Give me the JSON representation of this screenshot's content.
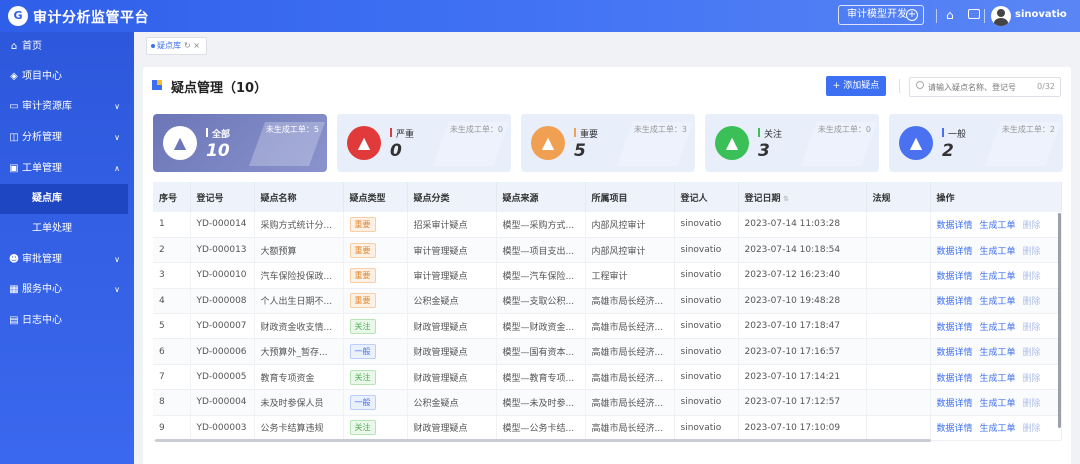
{
  "header": {
    "logo_glyph": "G",
    "title": "审计分析监管平台",
    "dev_button": "审计模型开发",
    "username": "sinovatio"
  },
  "sidebar": {
    "items": [
      {
        "label": "首页",
        "icon": "home-icon",
        "glyph": "⌂"
      },
      {
        "label": "项目中心",
        "icon": "layers-icon",
        "glyph": "◈"
      },
      {
        "label": "审计资源库",
        "icon": "folder-icon",
        "glyph": "▭"
      },
      {
        "label": "分析管理",
        "icon": "chart-icon",
        "glyph": "◫"
      },
      {
        "label": "工单管理",
        "icon": "ticket-icon",
        "glyph": "▣"
      },
      {
        "label": "审批管理",
        "icon": "user-icon",
        "glyph": "☻"
      },
      {
        "label": "服务中心",
        "icon": "grid-icon",
        "glyph": "▦"
      },
      {
        "label": "日志中心",
        "icon": "log-icon",
        "glyph": "▤"
      }
    ],
    "subitems": [
      {
        "label": "疑点库"
      },
      {
        "label": "工单处理"
      }
    ]
  },
  "tabs": [
    {
      "label": "疑点库",
      "tools": "↻ ×"
    }
  ],
  "page": {
    "title": "疑点管理（10）",
    "add_button": "+ 添加疑点",
    "search_placeholder": "请输入疑点名称、登记号",
    "search_count": "0/32"
  },
  "stats": [
    {
      "name": "全部",
      "count": "10",
      "ticket": "未生成工单：5",
      "color": "#ffffff",
      "circle": "#ffffff",
      "glyph_color": "#6b76b8"
    },
    {
      "name": "严重",
      "count": "0",
      "ticket": "未生成工单：0",
      "color": "#e03a3a",
      "circle": "#e03a3a",
      "glyph_color": "#ffffff"
    },
    {
      "name": "重要",
      "count": "5",
      "ticket": "未生成工单：3",
      "color": "#f0a050",
      "circle": "#f0a050",
      "glyph_color": "#ffffff"
    },
    {
      "name": "关注",
      "count": "3",
      "ticket": "未生成工单：0",
      "color": "#3bbf57",
      "circle": "#3bbf57",
      "glyph_color": "#ffffff"
    },
    {
      "name": "一般",
      "count": "2",
      "ticket": "未生成工单：2",
      "color": "#4a72f0",
      "circle": "#4a72f0",
      "glyph_color": "#ffffff"
    }
  ],
  "table": {
    "headers": [
      "序号",
      "登记号",
      "疑点名称",
      "疑点类型",
      "疑点分类",
      "疑点来源",
      "所属项目",
      "登记人",
      "登记日期",
      "法规",
      "操作"
    ],
    "actions": [
      "数据详情",
      "生成工单",
      "删除"
    ],
    "rows": [
      {
        "no": "1",
        "reg": "YD-000014",
        "name": "采购方式统计分...",
        "type": "重要",
        "tagclass": "imp",
        "cat": "招采审计疑点",
        "src": "模型—采购方式...",
        "proj": "内部风控审计",
        "user": "sinovatio",
        "date": "2023-07-14 11:03:28",
        "law": ""
      },
      {
        "no": "2",
        "reg": "YD-000013",
        "name": "大额预算",
        "type": "重要",
        "tagclass": "imp",
        "cat": "审计管理疑点",
        "src": "模型—项目支出...",
        "proj": "内部风控审计",
        "user": "sinovatio",
        "date": "2023-07-14 10:18:54",
        "law": ""
      },
      {
        "no": "3",
        "reg": "YD-000010",
        "name": "汽车保险投保政...",
        "type": "重要",
        "tagclass": "imp",
        "cat": "审计管理疑点",
        "src": "模型—汽车保险...",
        "proj": "工程审计",
        "user": "sinovatio",
        "date": "2023-07-12 16:23:40",
        "law": ""
      },
      {
        "no": "4",
        "reg": "YD-000008",
        "name": "个人出生日期不...",
        "type": "重要",
        "tagclass": "imp",
        "cat": "公积金疑点",
        "src": "模型—支取公积...",
        "proj": "高雄市局长经济...",
        "user": "sinovatio",
        "date": "2023-07-10 19:48:28",
        "law": ""
      },
      {
        "no": "5",
        "reg": "YD-000007",
        "name": "财政资金收支情...",
        "type": "关注",
        "tagclass": "att",
        "cat": "财政管理疑点",
        "src": "模型—财政资金...",
        "proj": "高雄市局长经济...",
        "user": "sinovatio",
        "date": "2023-07-10 17:18:47",
        "law": ""
      },
      {
        "no": "6",
        "reg": "YD-000006",
        "name": "大预算外_暂存...",
        "type": "一般",
        "tagclass": "gen",
        "cat": "财政管理疑点",
        "src": "模型—国有资本...",
        "proj": "高雄市局长经济...",
        "user": "sinovatio",
        "date": "2023-07-10 17:16:57",
        "law": ""
      },
      {
        "no": "7",
        "reg": "YD-000005",
        "name": "教育专项资金",
        "type": "关注",
        "tagclass": "att",
        "cat": "财政管理疑点",
        "src": "模型—教育专项...",
        "proj": "高雄市局长经济...",
        "user": "sinovatio",
        "date": "2023-07-10 17:14:21",
        "law": ""
      },
      {
        "no": "8",
        "reg": "YD-000004",
        "name": "未及时参保人员",
        "type": "一般",
        "tagclass": "gen",
        "cat": "公积金疑点",
        "src": "模型—未及时参...",
        "proj": "高雄市局长经济...",
        "user": "sinovatio",
        "date": "2023-07-10 17:12:57",
        "law": ""
      },
      {
        "no": "9",
        "reg": "YD-000003",
        "name": "公务卡结算违规",
        "type": "关注",
        "tagclass": "att",
        "cat": "财政管理疑点",
        "src": "模型—公务卡结...",
        "proj": "高雄市局长经济...",
        "user": "sinovatio",
        "date": "2023-07-10 17:10:09",
        "law": ""
      }
    ]
  }
}
